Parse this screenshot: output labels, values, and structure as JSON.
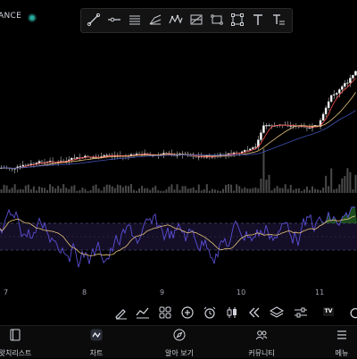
{
  "header": {
    "exchange_fragment": "ANCE",
    "live_status_color": "#26a69a"
  },
  "drawing_toolbar": {
    "tools": [
      "trend-line-icon",
      "horizontal-ray-icon",
      "parallel-channel-icon",
      "pitchfork-icon",
      "pattern-icon",
      "long-position-icon",
      "rectangle-icon",
      "select-frame-icon",
      "text-icon",
      "text-note-icon"
    ]
  },
  "chart": {
    "time_axis": [
      "7",
      "8",
      "9",
      "10",
      "11"
    ],
    "colors": {
      "up": "#ffffff",
      "down": "#333333",
      "ma_fast": "#ff5252",
      "ma_mid": "#e6c27a",
      "ma_slow": "#3f51b5",
      "rsi": "#5b4fd6",
      "rsi_ma": "#e6c27a",
      "band": "#1a1133"
    }
  },
  "chart_toolbar": {
    "tools": [
      "brush-icon",
      "indicators-icon",
      "grid-icon",
      "plus-circle-icon",
      "alarm-icon",
      "candles-icon",
      "rewind-icon",
      "layers-icon",
      "settings-sliders-icon",
      "tradingview-logo-icon",
      "undo-icon"
    ],
    "brand_badge": "TV"
  },
  "bottom_nav": {
    "items": [
      {
        "label": "왓치리스트",
        "icon": "watchlist-icon"
      },
      {
        "label": "차트",
        "icon": "chart-icon"
      },
      {
        "label": "알아 보기",
        "icon": "compass-icon"
      },
      {
        "label": "커뮤니티",
        "icon": "community-icon"
      },
      {
        "label": "메뉴",
        "icon": "menu-icon"
      }
    ]
  }
}
